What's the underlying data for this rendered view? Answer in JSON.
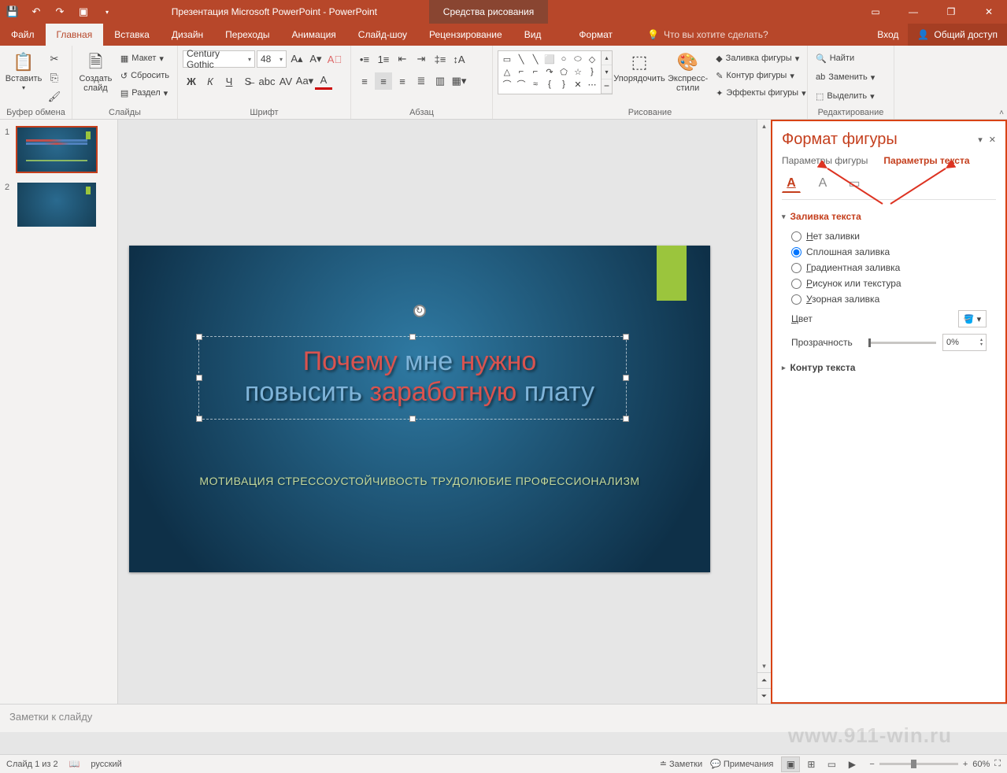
{
  "titlebar": {
    "title": "Презентация Microsoft PowerPoint - PowerPoint",
    "contextTab": "Средства рисования"
  },
  "tabs": {
    "file": "Файл",
    "home": "Главная",
    "insert": "Вставка",
    "design": "Дизайн",
    "transitions": "Переходы",
    "animations": "Анимация",
    "slideshow": "Слайд-шоу",
    "review": "Рецензирование",
    "view": "Вид",
    "format": "Формат",
    "tellme": "Что вы хотите сделать?",
    "signin": "Вход",
    "share": "Общий доступ"
  },
  "ribbon": {
    "clipboard": {
      "paste": "Вставить",
      "label": "Буфер обмена"
    },
    "slides": {
      "new": "Создать слайд",
      "layout": "Макет",
      "reset": "Сбросить",
      "section": "Раздел",
      "label": "Слайды"
    },
    "font": {
      "name": "Century Gothic",
      "size": "48",
      "label": "Шрифт"
    },
    "paragraph": {
      "label": "Абзац"
    },
    "drawing": {
      "arrange": "Упорядочить",
      "styles": "Экспресс-стили",
      "fill": "Заливка фигуры",
      "outline": "Контур фигуры",
      "effects": "Эффекты фигуры",
      "label": "Рисование"
    },
    "editing": {
      "find": "Найти",
      "replace": "Заменить",
      "select": "Выделить",
      "label": "Редактирование"
    }
  },
  "thumbnails": {
    "n1": "1",
    "n2": "2"
  },
  "slide": {
    "title_part1": "Почему ",
    "title_part2": "мне ",
    "title_part3": "нужно",
    "title2_part1": "повысить ",
    "title2_part2": "заработную ",
    "title2_part3": "плату",
    "subtitle": "МОТИВАЦИЯ СТРЕССОУСТОЙЧИВОСТЬ ТРУДОЛЮБИЕ ПРОФЕССИОНАЛИЗМ"
  },
  "notes": {
    "placeholder": "Заметки к слайду"
  },
  "pane": {
    "title": "Формат фигуры",
    "tab1": "Параметры фигуры",
    "tab2": "Параметры текста",
    "section_fill": "Заливка текста",
    "r_nofill": "Нет заливки",
    "r_solid": "Сплошная заливка",
    "r_gradient": "Градиентная заливка",
    "r_picture": "Рисунок или текстура",
    "r_pattern": "Узорная заливка",
    "color": "Цвет",
    "transparency": "Прозрачность",
    "transp_val": "0%",
    "section_outline": "Контур текста"
  },
  "statusbar": {
    "slideinfo": "Слайд 1 из 2",
    "lang": "русский",
    "notes": "Заметки",
    "comments": "Примечания",
    "zoom": "60%"
  },
  "watermark": "www.911-win.ru"
}
